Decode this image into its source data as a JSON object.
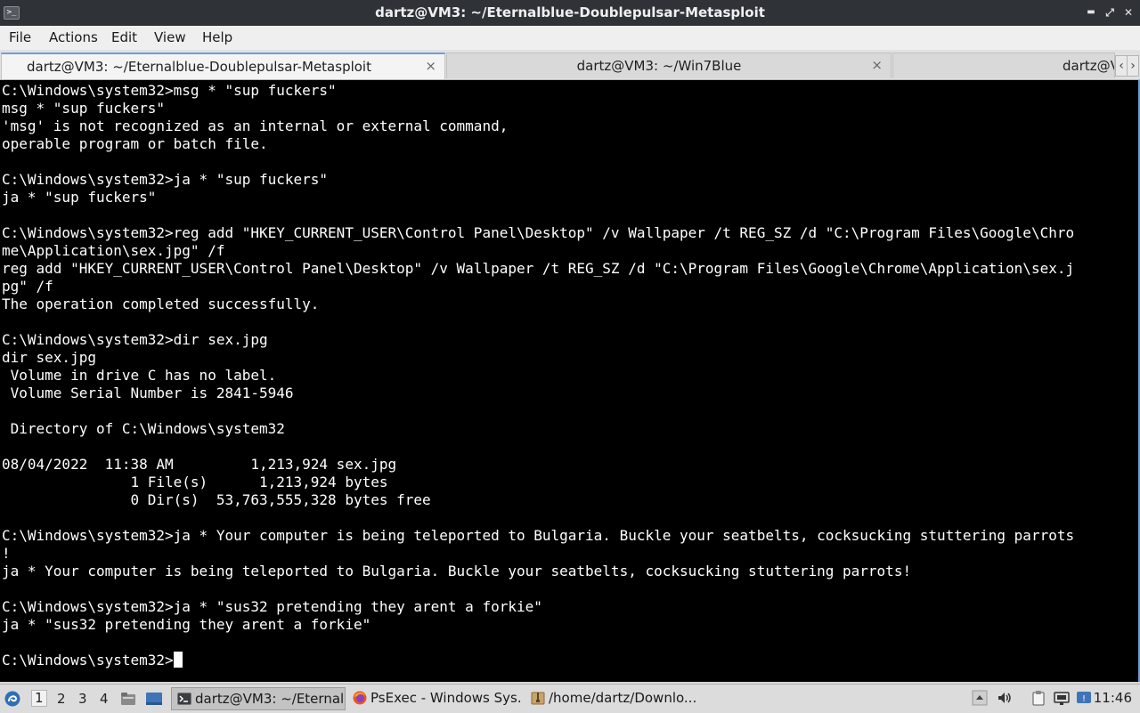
{
  "window": {
    "title": "dartz@VM3: ~/Eternalblue-Doublepulsar-Metasploit",
    "app_icon_glyph": ">_",
    "buttons": {
      "minimize": "▬",
      "maximize": "⤢",
      "close": "✕"
    }
  },
  "menu": {
    "items": [
      "File",
      "Actions",
      "Edit",
      "View",
      "Help"
    ]
  },
  "tabs": [
    {
      "label": "dartz@VM3: ~/Eternalblue-Doublepulsar-Metasploit",
      "close": "×",
      "active": true
    },
    {
      "label": "dartz@VM3: ~/Win7Blue",
      "close": "×",
      "active": false
    },
    {
      "label": "dartz@V",
      "close": "",
      "active": false
    }
  ],
  "tab_scroll": {
    "left": "‹",
    "right": "›"
  },
  "terminal": {
    "lines": [
      "C:\\Windows\\system32>msg * \"sup fuckers\"",
      "msg * \"sup fuckers\"",
      "'msg' is not recognized as an internal or external command,",
      "operable program or batch file.",
      "",
      "C:\\Windows\\system32>ja * \"sup fuckers\"",
      "ja * \"sup fuckers\"",
      "",
      "C:\\Windows\\system32>reg add \"HKEY_CURRENT_USER\\Control Panel\\Desktop\" /v Wallpaper /t REG_SZ /d \"C:\\Program Files\\Google\\Chro",
      "me\\Application\\sex.jpg\" /f",
      "reg add \"HKEY_CURRENT_USER\\Control Panel\\Desktop\" /v Wallpaper /t REG_SZ /d \"C:\\Program Files\\Google\\Chrome\\Application\\sex.j",
      "pg\" /f",
      "The operation completed successfully.",
      "",
      "C:\\Windows\\system32>dir sex.jpg",
      "dir sex.jpg",
      " Volume in drive C has no label.",
      " Volume Serial Number is 2841-5946",
      "",
      " Directory of C:\\Windows\\system32",
      "",
      "08/04/2022  11:38 AM         1,213,924 sex.jpg",
      "               1 File(s)      1,213,924 bytes",
      "               0 Dir(s)  53,763,555,328 bytes free",
      "",
      "C:\\Windows\\system32>ja * Your computer is being teleported to Bulgaria. Buckle your seatbelts, cocksucking stuttering parrots",
      "!",
      "ja * Your computer is being teleported to Bulgaria. Buckle your seatbelts, cocksucking stuttering parrots!",
      "",
      "C:\\Windows\\system32>ja * \"sus32 pretending they arent a forkie\"",
      "ja * \"sus32 pretending they arent a forkie\"",
      ""
    ],
    "prompt": "C:\\Windows\\system32>"
  },
  "taskbar": {
    "workspaces": [
      "1",
      "2",
      "3",
      "4"
    ],
    "active_workspace": "1",
    "tasks": [
      {
        "label": "dartz@VM3: ~/Eternal...",
        "icon": "terminal-icon",
        "active": true
      },
      {
        "label": "PsExec - Windows Sys...",
        "icon": "firefox-icon",
        "active": false
      },
      {
        "label": "/home/dartz/Downlo...",
        "icon": "archive-icon",
        "active": false
      }
    ],
    "clock": "11:46"
  }
}
